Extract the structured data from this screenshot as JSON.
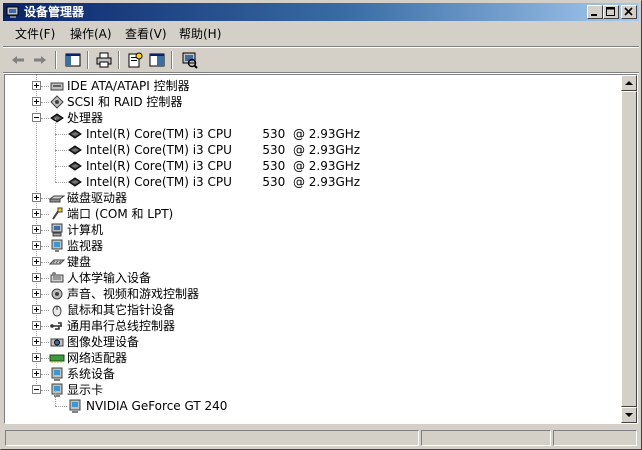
{
  "window": {
    "title": "设备管理器"
  },
  "menu": [
    "文件(F)",
    "操作(A)",
    "查看(V)",
    "帮助(H)"
  ],
  "tree": [
    {
      "label": "IDE ATA/ATAPI 控制器",
      "icon": "ide-controller-icon",
      "expanded": false
    },
    {
      "label": "SCSI 和 RAID 控制器",
      "icon": "scsi-controller-icon",
      "expanded": false
    },
    {
      "label": "处理器",
      "icon": "processor-icon",
      "expanded": true,
      "children": [
        {
          "label": "Intel(R) Core(TM) i3 CPU        530  @ 2.93GHz",
          "icon": "processor-icon"
        },
        {
          "label": "Intel(R) Core(TM) i3 CPU        530  @ 2.93GHz",
          "icon": "processor-icon"
        },
        {
          "label": "Intel(R) Core(TM) i3 CPU        530  @ 2.93GHz",
          "icon": "processor-icon"
        },
        {
          "label": "Intel(R) Core(TM) i3 CPU        530  @ 2.93GHz",
          "icon": "processor-icon"
        }
      ]
    },
    {
      "label": "磁盘驱动器",
      "icon": "disk-drive-icon",
      "expanded": false
    },
    {
      "label": "端口 (COM 和 LPT)",
      "icon": "port-icon",
      "expanded": false
    },
    {
      "label": "计算机",
      "icon": "computer-icon",
      "expanded": false
    },
    {
      "label": "监视器",
      "icon": "monitor-icon",
      "expanded": false
    },
    {
      "label": "键盘",
      "icon": "keyboard-icon",
      "expanded": false
    },
    {
      "label": "人体学输入设备",
      "icon": "hid-icon",
      "expanded": false
    },
    {
      "label": "声音、视频和游戏控制器",
      "icon": "sound-icon",
      "expanded": false
    },
    {
      "label": "鼠标和其它指针设备",
      "icon": "mouse-icon",
      "expanded": false
    },
    {
      "label": "通用串行总线控制器",
      "icon": "usb-icon",
      "expanded": false
    },
    {
      "label": "图像处理设备",
      "icon": "imaging-device-icon",
      "expanded": false
    },
    {
      "label": "网络适配器",
      "icon": "network-adapter-icon",
      "expanded": false
    },
    {
      "label": "系统设备",
      "icon": "system-device-icon",
      "expanded": false
    },
    {
      "label": "显示卡",
      "icon": "display-adapter-icon",
      "expanded": true,
      "children": [
        {
          "label": "NVIDIA GeForce GT 240",
          "icon": "display-adapter-icon"
        }
      ]
    }
  ]
}
